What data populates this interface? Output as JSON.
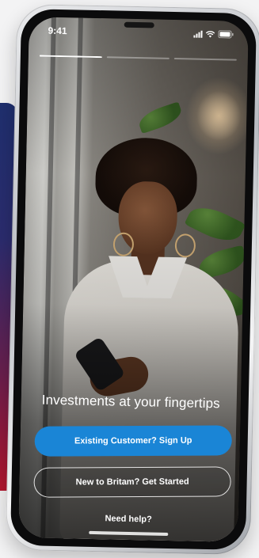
{
  "status_bar": {
    "time": "9:41"
  },
  "onboarding": {
    "progress_segments": [
      1,
      0,
      0
    ],
    "headline": "Investments at your fingertips",
    "primary_button": "Existing Customer? Sign Up",
    "secondary_button": "New to Britam? Get Started",
    "help_link": "Need help?"
  },
  "colors": {
    "primary_blue": "#1a85d6",
    "text_white": "#ffffff",
    "brand_stripe_navy": "#1f2f6e",
    "brand_stripe_red": "#b5152e"
  },
  "icons": [
    "signal-icon",
    "wifi-icon",
    "battery-icon"
  ]
}
